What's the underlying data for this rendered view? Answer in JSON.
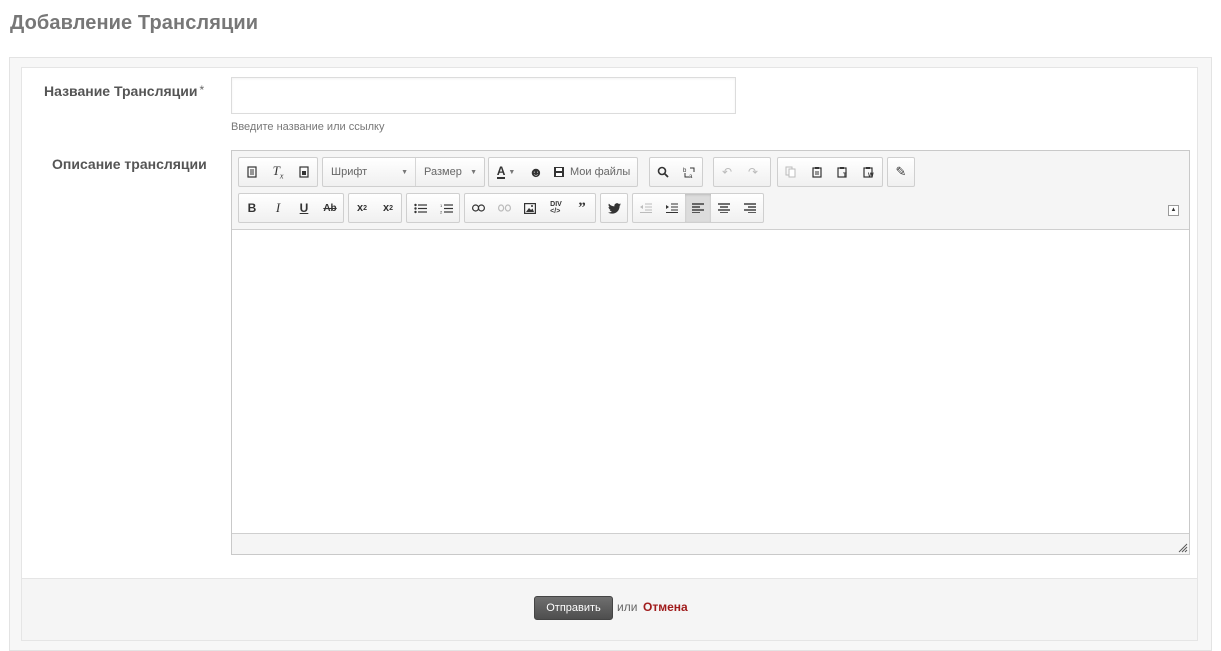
{
  "page": {
    "title": "Добавление Трансляции"
  },
  "form": {
    "title_field": {
      "label": "Название Трансляции",
      "required_mark": "*",
      "value": "",
      "help": "Введите название или ссылку"
    },
    "description_field": {
      "label": "Описание трансляции"
    },
    "editor": {
      "font_combo": "Шрифт",
      "size_combo": "Размер",
      "my_files": "Мои файлы",
      "content": ""
    },
    "actions": {
      "submit": "Отправить",
      "or": "или",
      "cancel": "Отмена"
    }
  },
  "colors": {
    "accent_cancel": "#a01c1c",
    "submit_bg": "#5a5a5a"
  }
}
